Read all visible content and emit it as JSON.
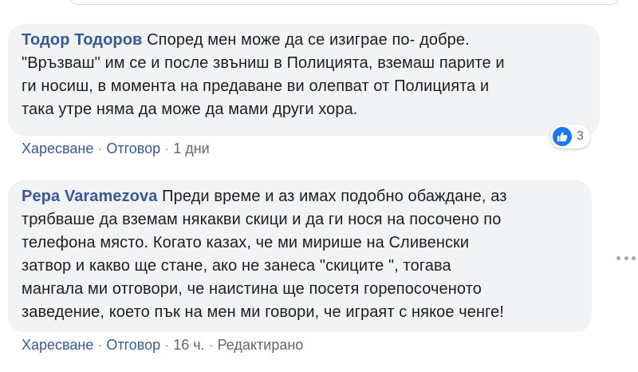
{
  "comments": [
    {
      "author": "Тодор Тодоров",
      "lines": [
        "Според мен може да се изиграе по- добре.",
        "\"Връзваш\" им се и после звъниш в Полицията, вземаш парите и",
        "ги носиш, в момента на предаване ви олепват от Полицията и",
        "така утре няма да може да мами други хора."
      ],
      "like_label": "Харесване",
      "reply_label": "Отговор",
      "time": "1 дни",
      "reaction_count": "3"
    },
    {
      "author": "Pepa Varamezova",
      "lines": [
        "Преди време и аз имах подобно обаждане, аз",
        "трябваше да вземам някакви скици и да ги нося на посочено по",
        "телефона място. Когато казах, че ми мирише на Сливенски",
        "затвор и какво ще стане, ако не занеса \"скиците \", тогава",
        "мангала ми отговори, че наистина ще посетя горепосоченото",
        "заведение, което пък на мен ми говори, че играят с някое ченге!"
      ],
      "like_label": "Харесване",
      "reply_label": "Отговор",
      "time": "16 ч.",
      "edited": "Редактирано"
    }
  ],
  "colors": {
    "author": "#385898",
    "bubble": "#f2f3f5",
    "like_blue": "#1877f2"
  },
  "icons": {
    "reaction": "like-thumb-icon",
    "options": "more-options-icon"
  }
}
